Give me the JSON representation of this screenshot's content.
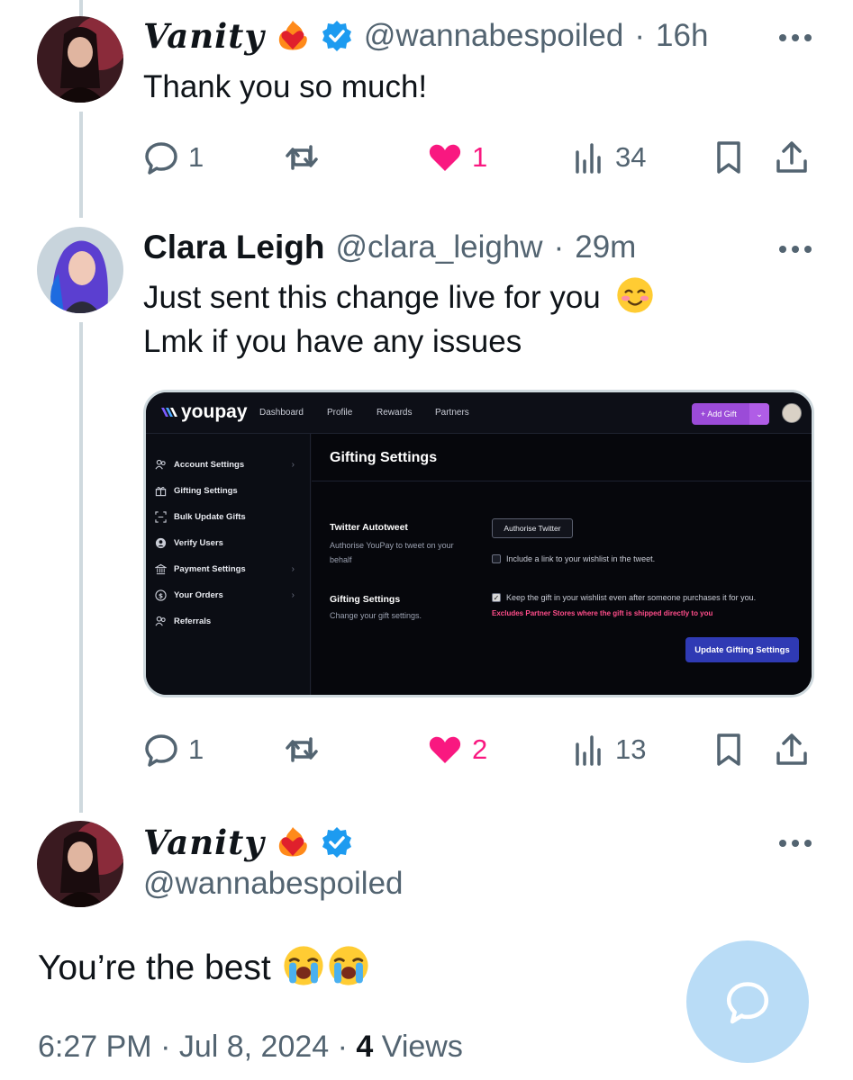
{
  "tweets": [
    {
      "name": "Vanity",
      "handle": "@wannabespoiled",
      "time": "16h",
      "text": "Thank you so much!",
      "replies": "1",
      "likes": "1",
      "views": "34"
    },
    {
      "name": "Clara Leigh",
      "handle": "@clara_leighw",
      "time": "29m",
      "text_line1": "Just sent this change live for you",
      "text_line2": "Lmk if you have any issues",
      "replies": "1",
      "likes": "2",
      "views": "13"
    }
  ],
  "main_tweet": {
    "name": "Vanity",
    "handle": "@wannabespoiled",
    "text": "You’re the best",
    "timestamp": "6:27 PM · Jul 8, 2024 ·",
    "views_count": "4",
    "views_label": "Views"
  },
  "youpay": {
    "logo": "youpay",
    "nav": [
      "Dashboard",
      "Profile",
      "Rewards",
      "Partners"
    ],
    "add_gift": "+ Add Gift",
    "sidebar": [
      {
        "label": "Account Settings",
        "icon": "users-icon",
        "chevron": true
      },
      {
        "label": "Gifting Settings",
        "icon": "gift-icon",
        "chevron": false
      },
      {
        "label": "Bulk Update Gifts",
        "icon": "scan-icon",
        "chevron": false
      },
      {
        "label": "Verify Users",
        "icon": "user-circle-icon",
        "chevron": false
      },
      {
        "label": "Payment Settings",
        "icon": "bank-icon",
        "chevron": true
      },
      {
        "label": "Your Orders",
        "icon": "dollar-icon",
        "chevron": true
      },
      {
        "label": "Referrals",
        "icon": "users-icon",
        "chevron": false
      }
    ],
    "page_title": "Gifting Settings",
    "twitter_label": "Twitter Autotweet",
    "twitter_desc_1": "Authorise YouPay to tweet on your",
    "twitter_desc_2": "behalf",
    "authorise_button": "Authorise Twitter",
    "include_link": "Include a link to your wishlist in the tweet.",
    "gifting_label": "Gifting Settings",
    "gifting_desc": "Change your gift settings.",
    "keep_gift": "Keep the gift in your wishlist even after someone purchases it for you.",
    "excludes": "Excludes Partner Stores where the gift is shipped directly to you",
    "update_button": "Update Gifting Settings"
  },
  "colors": {
    "like": "#f91880",
    "verified": "#1d9bf0",
    "muted": "#536471",
    "fab": "#b9dcf6"
  }
}
